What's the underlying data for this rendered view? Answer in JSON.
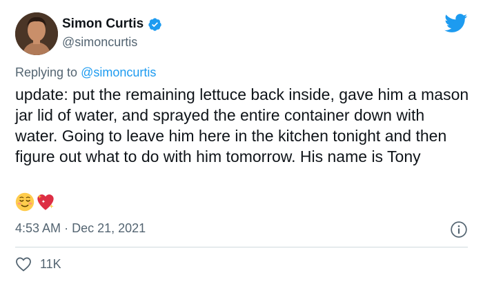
{
  "author": {
    "display_name": "Simon Curtis",
    "handle": "@simoncurtis",
    "verified": true
  },
  "reply_context": {
    "prefix": "Replying to",
    "mention": "@simoncurtis"
  },
  "tweet": {
    "text": "update: put the remaining lettuce back inside, gave him a mason jar lid of water, and sprayed the entire container down with water. Going to leave him here in the kitchen tonight and then figure out what to do with him tomorrow. His name is Tony",
    "emojis": [
      "relieved-face-emoji",
      "sparkling-heart-emoji"
    ]
  },
  "timestamp": {
    "time": "4:53 AM",
    "separator": "·",
    "date": "Dec 21, 2021"
  },
  "engagement": {
    "likes": "11K"
  },
  "colors": {
    "brand_blue": "#1d9bf0",
    "secondary_text": "#536471",
    "divider": "#cfd9de"
  }
}
